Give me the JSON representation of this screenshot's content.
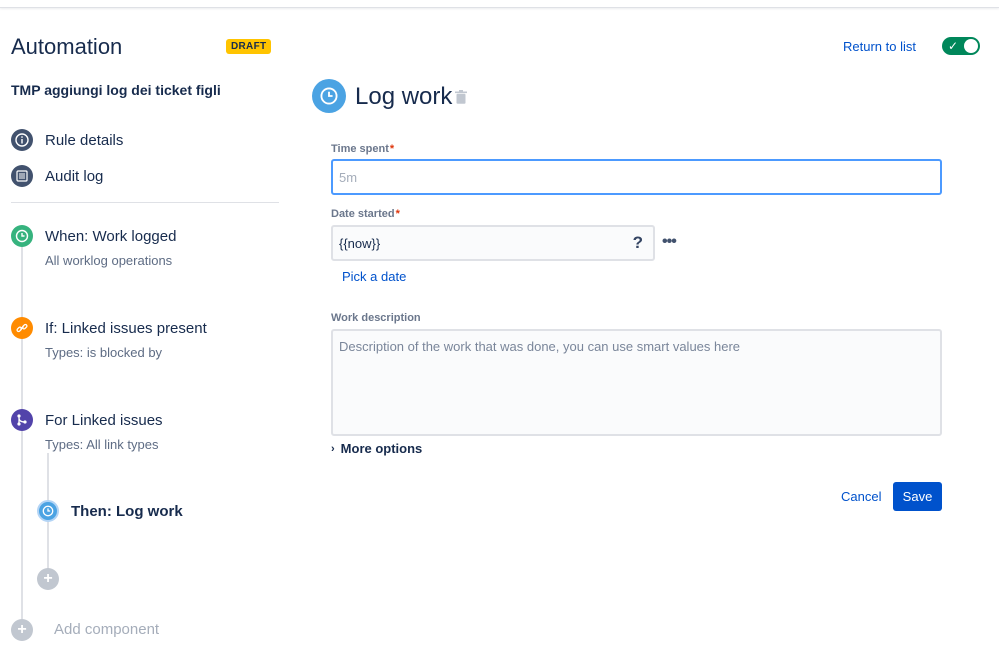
{
  "header": {
    "title": "Automation",
    "status_badge": "DRAFT",
    "return_link": "Return to list",
    "toggle_enabled": true
  },
  "rule": {
    "name": "TMP aggiungi log dei ticket figli"
  },
  "nav": {
    "rule_details": "Rule details",
    "audit_log": "Audit log"
  },
  "steps": {
    "trigger": {
      "title": "When: Work logged",
      "subtitle": "All worklog operations",
      "color": "#36b37e",
      "icon": "clock-icon"
    },
    "condition": {
      "title": "If: Linked issues present",
      "subtitle": "Types: is blocked by",
      "color": "#ff8b00",
      "icon": "link-icon"
    },
    "branch": {
      "title": "For Linked issues",
      "subtitle": "Types: All link types",
      "color": "#5243aa",
      "icon": "branch-icon"
    },
    "action": {
      "title": "Then: Log work",
      "color": "#4ba3e3",
      "icon": "clock-icon"
    }
  },
  "add_component_label": "Add component",
  "panel": {
    "title": "Log work",
    "time_spent": {
      "label": "Time spent",
      "required_mark": "*",
      "placeholder": "5m",
      "value": ""
    },
    "date_started": {
      "label": "Date started",
      "required_mark": "*",
      "value": "{{now}}",
      "help": "?",
      "more": "•••",
      "pick_date": "Pick a date"
    },
    "work_description": {
      "label": "Work description",
      "placeholder": "Description of the work that was done, you can use smart values here"
    },
    "more_options": "More options",
    "cancel": "Cancel",
    "save": "Save"
  },
  "colors": {
    "primary": "#0052cc",
    "toggle_on": "#00875a",
    "draft": "#ffc400"
  }
}
